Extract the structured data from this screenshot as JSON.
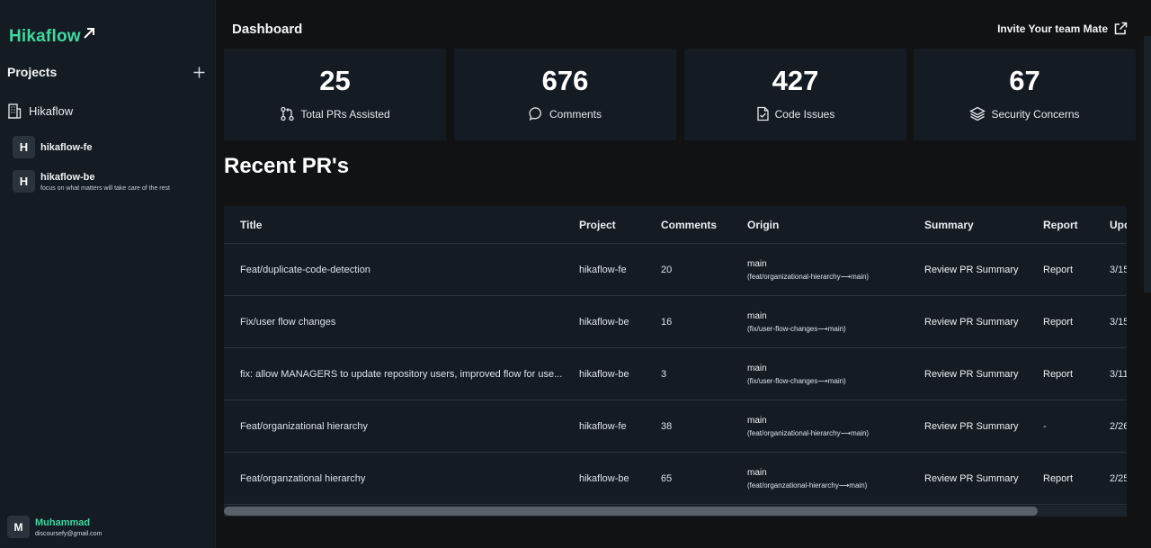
{
  "sidebar": {
    "logo_text": "Hikaflow",
    "projects_title": "Projects",
    "org_name": "Hikaflow",
    "projects": [
      {
        "initial": "H",
        "name": "hikaflow-fe",
        "description": ""
      },
      {
        "initial": "H",
        "name": "hikaflow-be",
        "description": "focus on what matters will take care of the rest"
      }
    ],
    "user": {
      "initial": "M",
      "name": "Muhammad",
      "email": "discoursefy@gmail.com"
    }
  },
  "header": {
    "title": "Dashboard",
    "invite_label": "Invite Your team Mate"
  },
  "stats": [
    {
      "value": "25",
      "label": "Total PRs Assisted",
      "icon": "git-pull-request-icon"
    },
    {
      "value": "676",
      "label": "Comments",
      "icon": "comment-icon"
    },
    {
      "value": "427",
      "label": "Code Issues",
      "icon": "file-check-icon"
    },
    {
      "value": "67",
      "label": "Security Concerns",
      "icon": "layers-icon"
    }
  ],
  "recent": {
    "title": "Recent PR's",
    "columns": [
      "Title",
      "Project",
      "Comments",
      "Origin",
      "Summary",
      "Report",
      "Upd"
    ],
    "rows": [
      {
        "title": "Feat/duplicate-code-detection",
        "project": "hikaflow-fe",
        "comments": "20",
        "origin_branch": "main",
        "origin_path": "(feat/organizational-hierarchy⟶main)",
        "summary": "Review PR Summary",
        "report": "Report",
        "updated": "3/15"
      },
      {
        "title": "Fix/user flow changes",
        "project": "hikaflow-be",
        "comments": "16",
        "origin_branch": "main",
        "origin_path": "(fix/user-flow-changes⟶main)",
        "summary": "Review PR Summary",
        "report": "Report",
        "updated": "3/15"
      },
      {
        "title": "fix: allow MANAGERS to update repository users, improved flow for use...",
        "project": "hikaflow-be",
        "comments": "3",
        "origin_branch": "main",
        "origin_path": "(fix/user-flow-changes⟶main)",
        "summary": "Review PR Summary",
        "report": "Report",
        "updated": "3/11"
      },
      {
        "title": "Feat/organizational hierarchy",
        "project": "hikaflow-fe",
        "comments": "38",
        "origin_branch": "main",
        "origin_path": "(feat/organizational-hierarchy⟶main)",
        "summary": "Review PR Summary",
        "report": "-",
        "updated": "2/26"
      },
      {
        "title": "Feat/organzational hierarchy",
        "project": "hikaflow-be",
        "comments": "65",
        "origin_branch": "main",
        "origin_path": "(feat/organzational-hierarchy⟶main)",
        "summary": "Review PR Summary",
        "report": "Report",
        "updated": "2/25"
      }
    ]
  },
  "colors": {
    "accent": "#3ed9a1",
    "background": "#111213",
    "panel": "#141b23"
  }
}
